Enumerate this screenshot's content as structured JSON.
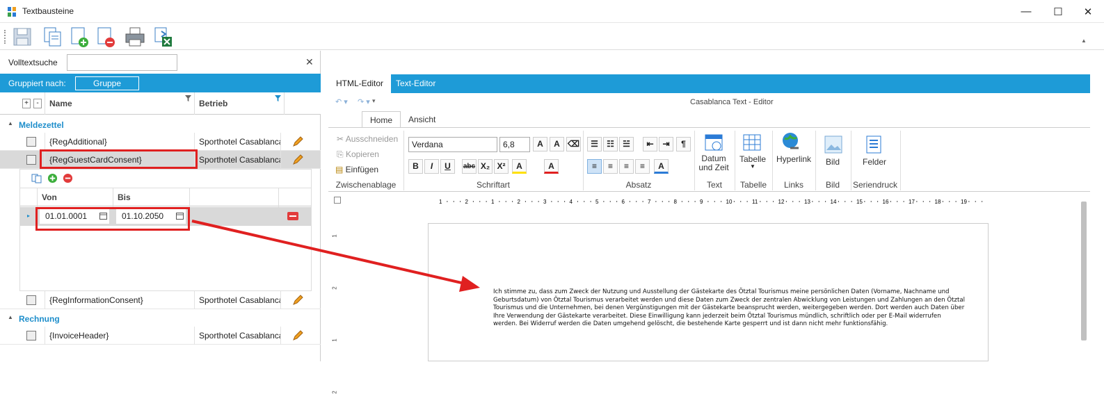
{
  "window": {
    "title": "Textbausteine",
    "min": "—",
    "max": "☐",
    "close": "✕"
  },
  "toolbar": {
    "icons": [
      "save-icon",
      "copy-icon",
      "add-icon",
      "delete-icon",
      "print-icon",
      "excel-export-icon"
    ]
  },
  "search": {
    "label": "Volltextsuche",
    "value": "",
    "clear": "✕"
  },
  "grouping": {
    "label": "Gruppiert nach:",
    "button": "Gruppe"
  },
  "grid": {
    "expand": "+",
    "collapse": "-",
    "col_name": "Name",
    "col_betrieb": "Betrieb"
  },
  "groups": [
    {
      "label": "Meldezettel",
      "rows": [
        {
          "name": "{RegAdditional}",
          "betrieb": "Sporthotel Casablanca"
        },
        {
          "name": "{RegGuestCardConsent}",
          "betrieb": "Sporthotel Casablanca"
        },
        {
          "name": "{RegInformationConsent}",
          "betrieb": "Sporthotel Casablanca"
        }
      ]
    },
    {
      "label": "Rechnung",
      "rows": [
        {
          "name": "{InvoiceHeader}",
          "betrieb": "Sporthotel Casablanca"
        }
      ]
    }
  ],
  "subgrid": {
    "col_von": "Von",
    "col_bis": "Bis",
    "von": "01.01.0001",
    "bis": "01.10.2050"
  },
  "editor": {
    "tabs": [
      "HTML-Editor",
      "Text-Editor"
    ],
    "title": "Casablanca Text - Editor",
    "ribbon_tabs": [
      "Home",
      "Ansicht"
    ],
    "clipboard": {
      "cut": "Ausschneiden",
      "copy": "Kopieren",
      "paste": "Einfügen",
      "label": "Zwischenablage"
    },
    "font": {
      "family": "Verdana",
      "size": "6,8",
      "label": "Schriftart"
    },
    "paragraph": {
      "label": "Absatz"
    },
    "text": {
      "btn": "Datum und Zeit",
      "label": "Text"
    },
    "table": {
      "btn": "Tabelle",
      "label": "Tabelle"
    },
    "links": {
      "btn": "Hyperlink",
      "label": "Links"
    },
    "image": {
      "btn": "Bild",
      "label": "Bild"
    },
    "mail": {
      "btn": "Felder",
      "label": "Seriendruck"
    },
    "ruler": [
      "1",
      "2",
      "1",
      "2",
      "3",
      "4",
      "5",
      "6",
      "7",
      "8",
      "9",
      "10",
      "11",
      "12",
      "13",
      "14",
      "15",
      "16",
      "17",
      "18",
      "19"
    ],
    "vruler": [
      "1",
      "2",
      "1",
      "2"
    ],
    "document": "Ich stimme zu, dass zum Zweck der Nutzung und Ausstellung der Gästekarte des Ötztal Tourismus meine persönlichen Daten (Vorname, Nachname und Geburtsdatum) von Ötztal Tourismus verarbeitet werden und diese Daten zum Zweck der zentralen Abwicklung von Leistungen und Zahlungen an den Ötztal Tourismus und die Unternehmen, bei denen Vergünstigungen mit der Gästekarte beansprucht werden, weitergegeben werden. Dort werden auch Daten über Ihre Verwendung der Gästekarte verarbeitet. Diese Einwilligung kann jederzeit beim Ötztal Tourismus mündlich, schriftlich oder per E-Mail widerrufen werden. Bei Widerruf werden die Daten umgehend gelöscht, die bestehende Karte gesperrt und ist dann nicht mehr funktionsfähig."
  },
  "colors": {
    "accent": "#1e9bd7",
    "highlight": "#e02020",
    "group_text": "#1e8ecb"
  }
}
